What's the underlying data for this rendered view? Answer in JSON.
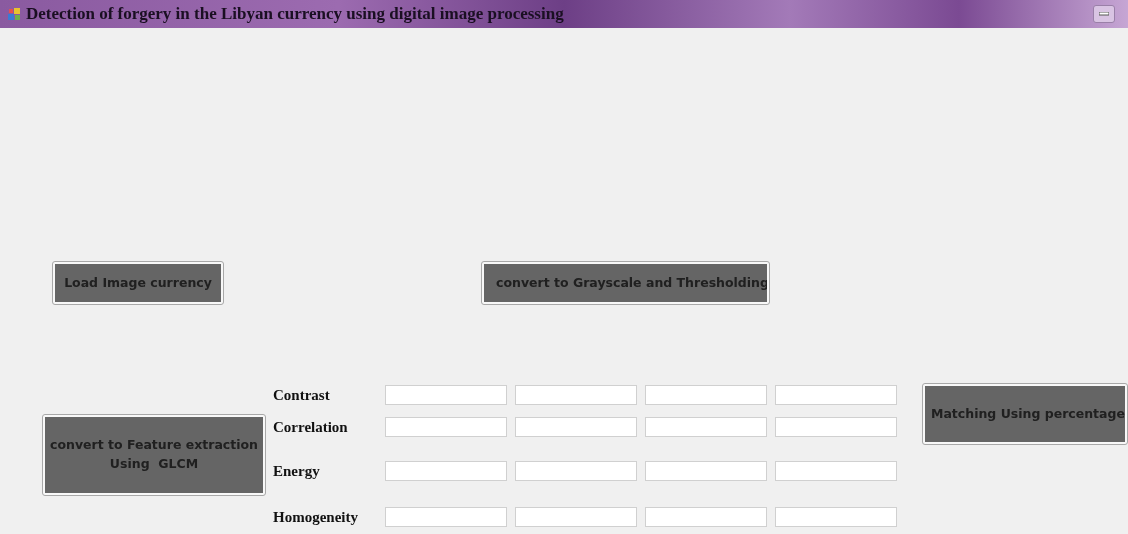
{
  "window": {
    "title": "Detection of forgery in the Libyan currency using digital image processing"
  },
  "top_buttons": [
    {
      "label": "Load Image currency"
    },
    {
      "label": "convert to Grayscale and Thresholding"
    }
  ],
  "feature_button": {
    "label": "convert to Feature extraction Using  GLCM"
  },
  "features": [
    {
      "label": "Contrast",
      "fields": [
        {
          "kind": "text-field"
        },
        {
          "kind": "text-field"
        },
        {
          "kind": "text-field"
        },
        {
          "kind": "text-field"
        }
      ]
    },
    {
      "label": "Correlation",
      "fields": [
        {
          "kind": "text-field"
        },
        {
          "kind": "text-field"
        },
        {
          "kind": "text-field"
        },
        {
          "kind": "text-field"
        }
      ]
    },
    {
      "label": "Energy",
      "fields": [
        {
          "kind": "text-field"
        },
        {
          "kind": "text-field"
        },
        {
          "kind": "text-field"
        },
        {
          "kind": "text-field"
        }
      ]
    },
    {
      "label": "Homogeneity",
      "fields": [
        {
          "kind": "text-field"
        },
        {
          "kind": "text-field"
        },
        {
          "kind": "text-field"
        },
        {
          "kind": "text-field"
        }
      ]
    }
  ],
  "match_button": {
    "label": "Matching Using percentage"
  }
}
